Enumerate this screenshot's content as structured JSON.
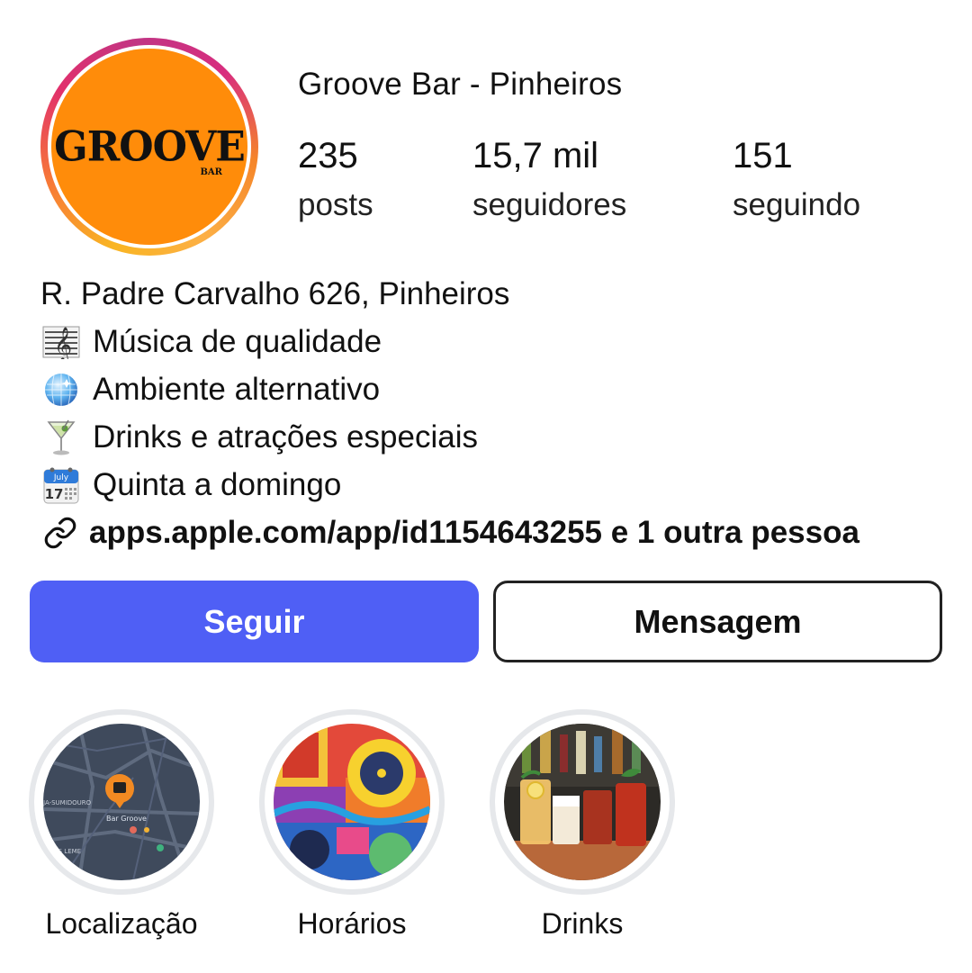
{
  "profile": {
    "name": "Groove Bar - Pinheiros",
    "avatar": {
      "logo_text": "GROOVE",
      "logo_sub": "BAR"
    }
  },
  "stats": [
    {
      "value": "235",
      "label": "posts"
    },
    {
      "value": "15,7 mil",
      "label": "seguidores"
    },
    {
      "value": "151",
      "label": "seguindo"
    }
  ],
  "bio": {
    "address": "R. Padre Carvalho 626, Pinheiros",
    "lines": [
      {
        "icon": "musical-score-icon",
        "text": "Música de qualidade"
      },
      {
        "icon": "mirror-ball-icon",
        "text": "Ambiente alternativo"
      },
      {
        "icon": "cocktail-glass-icon",
        "text": "Drinks e atrações especiais"
      },
      {
        "icon": "calendar-icon",
        "text": "Quinta a domingo",
        "calendar_month": "July",
        "calendar_day": "17"
      }
    ],
    "link": {
      "icon": "link-icon",
      "text": "apps.apple.com/app/id1154643255 e 1 outra pessoa"
    }
  },
  "buttons": {
    "follow": "Seguir",
    "message": "Mensagem"
  },
  "highlights": [
    {
      "label": "Localização",
      "map_labels": [
        "JA-SUMIDOURO",
        "Bar Groove",
        "PAIS LEME"
      ]
    },
    {
      "label": "Horários"
    },
    {
      "label": "Drinks"
    }
  ],
  "colors": {
    "follow_button": "#4f5ff5",
    "avatar_bg": "#ff8c0a",
    "highlight_ring": "#e6e8eb"
  }
}
